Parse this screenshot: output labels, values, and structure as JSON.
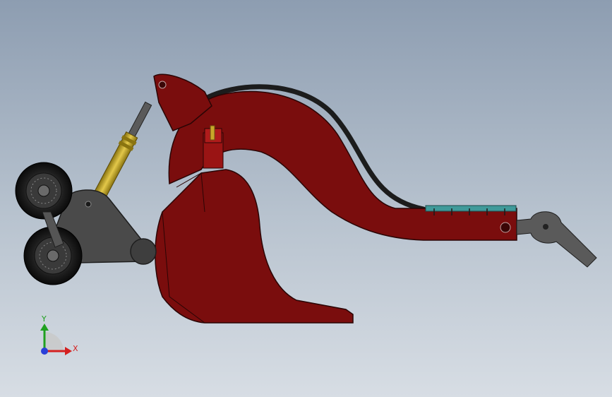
{
  "triad": {
    "y_label": "Y",
    "x_label": "X",
    "y_color": "#1fa01f",
    "x_color": "#d42020",
    "z_color": "#2a3fd8"
  },
  "colors": {
    "frame_red": "#7a0d0d",
    "frame_edge": "#2a0505",
    "bracket_gray": "#4a4a4a",
    "cylinder_gold": "#c9a82a",
    "hose_black": "#1c1c1c",
    "strip_teal": "#3f9a9a"
  }
}
